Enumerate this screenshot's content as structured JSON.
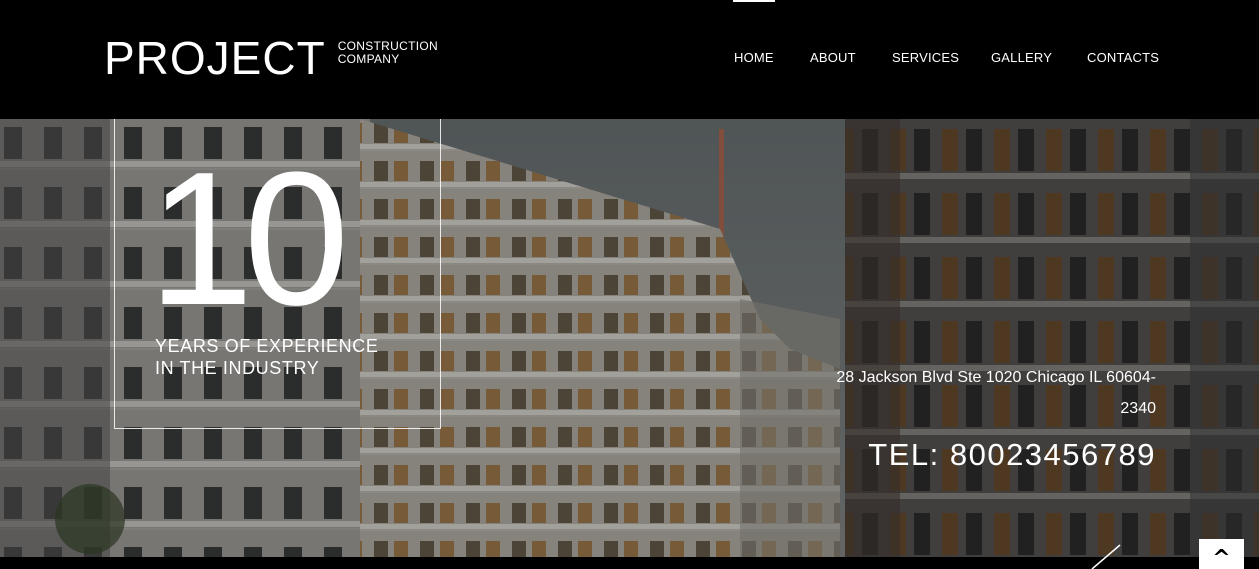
{
  "brand": {
    "name": "PROJECT",
    "tagline_line1": "CONSTRUCTION",
    "tagline_line2": "COMPANY"
  },
  "nav": {
    "items": [
      {
        "label": "HOME",
        "active": true
      },
      {
        "label": "ABOUT",
        "active": false
      },
      {
        "label": "SERVICES",
        "active": false
      },
      {
        "label": "GALLERY",
        "active": false
      },
      {
        "label": "CONTACTS",
        "active": false
      }
    ]
  },
  "hero": {
    "years": "10",
    "caption_line1": "YEARS OF EXPERIENCE",
    "caption_line2": "IN THE INDUSTRY",
    "address": "28 Jackson Blvd Ste 1020 Chicago IL 60604-2340",
    "phone": "TEL: 80023456789"
  },
  "scroll_top": {
    "icon": "chevron-up-icon",
    "glyph": "^"
  },
  "colors": {
    "header_bg": "#000000",
    "text": "#ffffff",
    "scroll_button_bg": "#ffffff"
  }
}
